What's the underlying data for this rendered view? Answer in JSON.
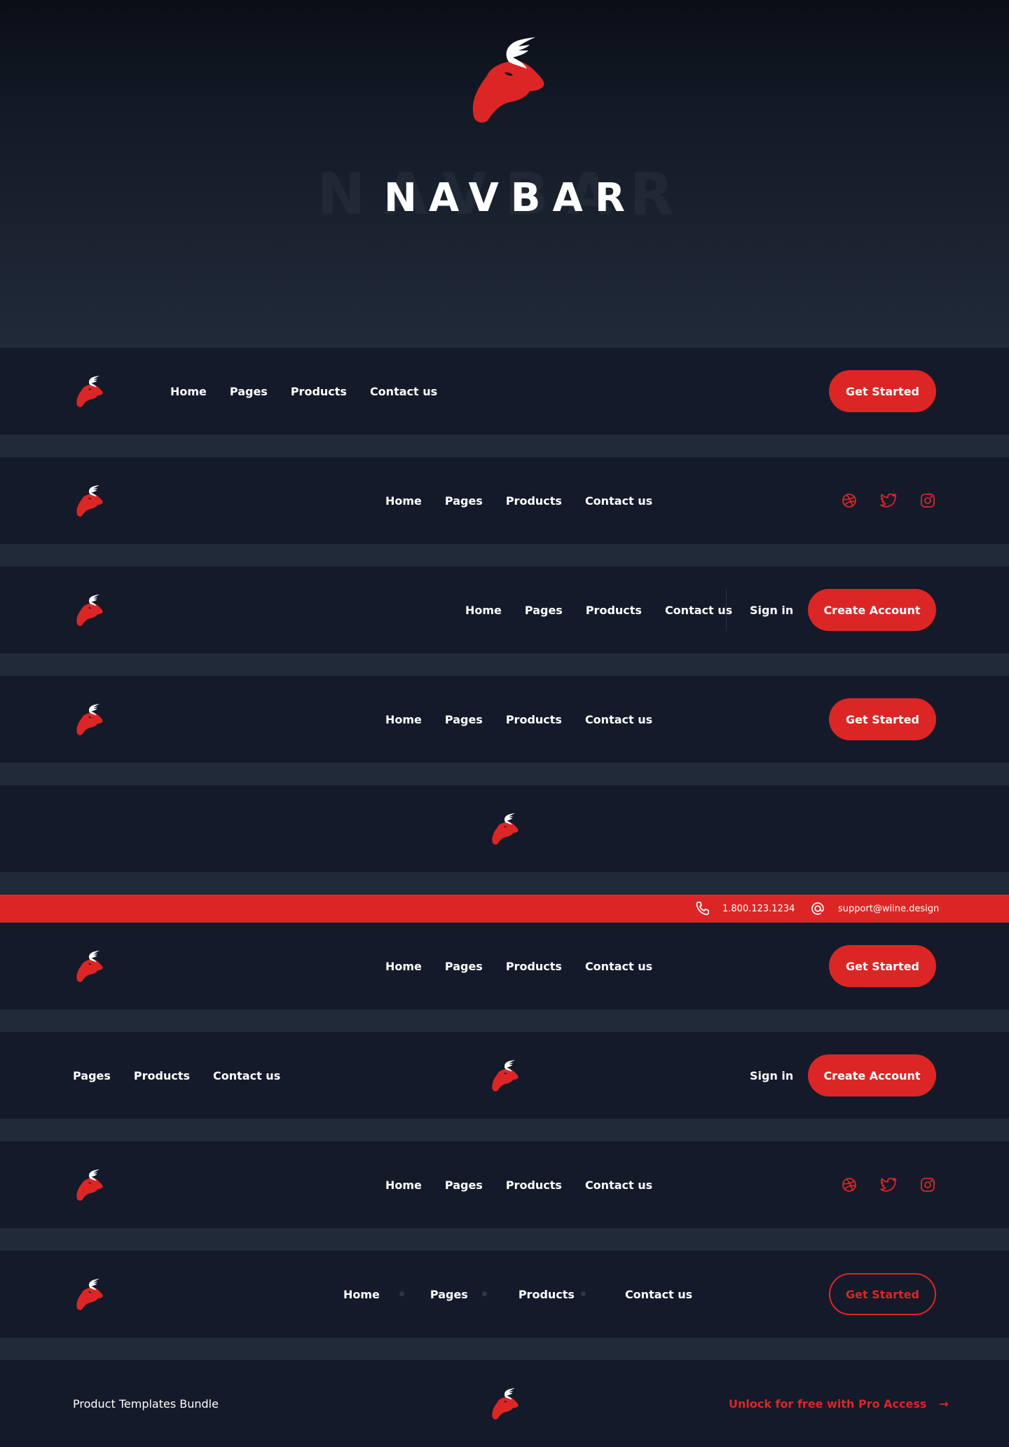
{
  "hero": {
    "title": "NAVBAR",
    "ghost_title": "NAVBAR"
  },
  "colors": {
    "accent": "#dc2626",
    "background": "#212a39",
    "bar_background": "#141a29",
    "hero_top": "#0a0e17"
  },
  "icons": {
    "logo": "bull-head-logo",
    "dribbble": "dribbble-icon",
    "twitter": "twitter-icon",
    "instagram": "instagram-icon",
    "phone": "phone-icon",
    "email": "at-sign-icon",
    "arrow": "arrow-right-icon"
  },
  "navbar1": {
    "links": [
      "Home",
      "Pages",
      "Products",
      "Contact us"
    ],
    "cta": "Get Started"
  },
  "navbar2": {
    "links": [
      "Home",
      "Pages",
      "Products",
      "Contact us"
    ]
  },
  "navbar3": {
    "links": [
      "Home",
      "Pages",
      "Products",
      "Contact us"
    ],
    "signin": "Sign in",
    "cta": "Create Account"
  },
  "navbar4": {
    "links": [
      "Home",
      "Pages",
      "Products",
      "Contact us"
    ],
    "cta": "Get Started"
  },
  "navbar6": {
    "phone": "1.800.123.1234",
    "email": "support@wiine.design",
    "links": [
      "Home",
      "Pages",
      "Products",
      "Contact us"
    ],
    "cta": "Get Started"
  },
  "navbar7": {
    "links": [
      "Pages",
      "Products",
      "Contact us"
    ],
    "signin": "Sign in",
    "cta": "Create Account"
  },
  "navbar8": {
    "links": [
      "Home",
      "Pages",
      "Products",
      "Contact us"
    ]
  },
  "navbar9": {
    "links": [
      "Home",
      "Pages",
      "Products",
      "Contact us"
    ],
    "cta": "Get Started"
  },
  "footer": {
    "left_text": "Product Templates Bundle",
    "right_text": "Unlock for free with Pro Access",
    "arrow": "→"
  }
}
